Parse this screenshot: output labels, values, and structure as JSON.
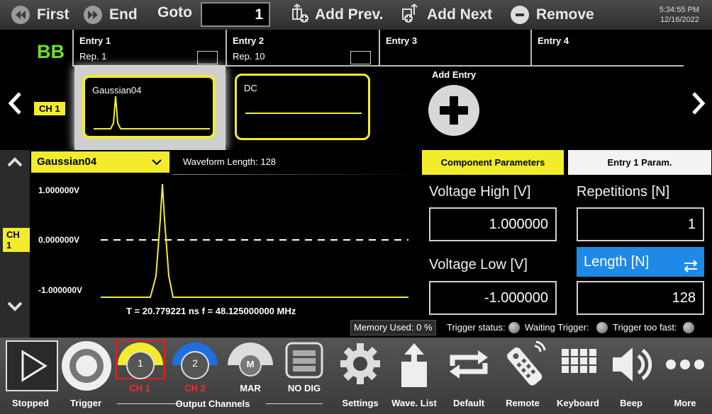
{
  "toolbar": {
    "first_label": "First",
    "end_label": "End",
    "goto_label": "Goto",
    "goto_value": "1",
    "add_prev_label": "Add Prev.",
    "add_next_label": "Add Next",
    "remove_label": "Remove",
    "clock_time": "5:34:55 PM",
    "clock_date": "12/16/2022"
  },
  "sequence": {
    "bb_label": "BB",
    "channel_label": "CH 1",
    "entries": [
      {
        "title": "Entry  1",
        "rep": "Rep.  1"
      },
      {
        "title": "Entry  2",
        "rep": "Rep.  10"
      },
      {
        "title": "Entry  3"
      },
      {
        "title": "Entry  4"
      }
    ],
    "cards": [
      {
        "name": "Gaussian04"
      },
      {
        "name": "DC"
      }
    ],
    "add_entry_label": "Add Entry"
  },
  "editor": {
    "waveform_name": "Gaussian04",
    "waveform_length": "Waveform Length:  128",
    "channel_label": "CH 1",
    "y_high": "1.000000V",
    "y_mid": "0.000000V",
    "y_low": "-1.000000V",
    "time_freq": "T =  20.779221 ns   f =  48.125000000 MHz",
    "trace_color": "#f2ec2c"
  },
  "params": {
    "component_tab": "Component Parameters",
    "entry_tab": "Entry  1  Param.",
    "voltage_high_label": "Voltage High [V]",
    "voltage_high_value": "1.000000",
    "voltage_low_label": "Voltage Low [V]",
    "voltage_low_value": "-1.000000",
    "repetitions_label": "Repetitions [N]",
    "repetitions_value": "1",
    "length_label": "Length [N]",
    "length_value": "128"
  },
  "status": {
    "memory_used": "Memory Used:   0 %",
    "trigger_status": "Trigger status:",
    "waiting_trigger": "Waiting Trigger:",
    "trigger_too_fast": "Trigger too fast:"
  },
  "bottom": {
    "stopped": "Stopped",
    "trigger": "Trigger",
    "output_channels": "Output Channels",
    "ch1": "CH 1",
    "ch2": "CH 2",
    "mar": "MAR",
    "no_dig": "NO DIG",
    "settings": "Settings",
    "wave_list": "Wave. List",
    "default": "Default",
    "remote": "Remote",
    "keyboard": "Keyboard",
    "beep": "Beep",
    "more": "More",
    "ch1_badge": "1",
    "ch2_badge": "2",
    "mar_badge": "M"
  },
  "colors": {
    "accent_yellow": "#f2ec2c",
    "bb_green": "#6ddf2a",
    "length_blue": "#1e8ae6",
    "ch_red": "#ff2a2a",
    "ch2_blue": "#1f6fe0"
  }
}
